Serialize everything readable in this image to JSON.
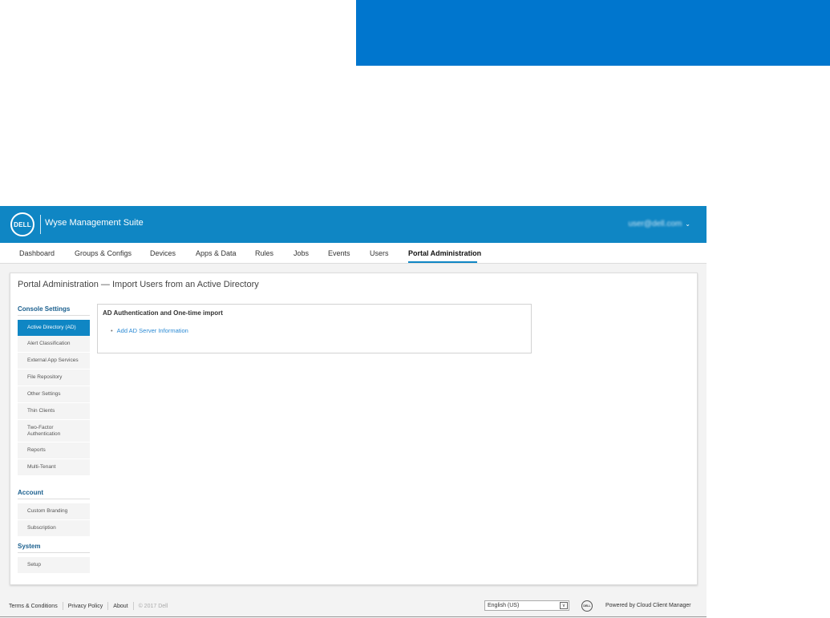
{
  "header": {
    "logo_text": "DELL",
    "app_title": "Wyse Management Suite",
    "user_email": "user@dell.com",
    "user_chevron": "⌄"
  },
  "nav": {
    "items": [
      {
        "label": "Dashboard"
      },
      {
        "label": "Groups & Configs"
      },
      {
        "label": "Devices"
      },
      {
        "label": "Apps & Data"
      },
      {
        "label": "Rules"
      },
      {
        "label": "Jobs"
      },
      {
        "label": "Events"
      },
      {
        "label": "Users"
      },
      {
        "label": "Portal Administration",
        "active": true
      }
    ]
  },
  "page": {
    "title": "Portal Administration — Import Users from an Active Directory"
  },
  "sidebar": {
    "console_heading": "Console Settings",
    "console_items": [
      {
        "label": "Active Directory (AD)",
        "active": true
      },
      {
        "label": "Alert Classification"
      },
      {
        "label": "External App Services"
      },
      {
        "label": "File Repository"
      },
      {
        "label": "Other Settings"
      },
      {
        "label": "Thin Clients"
      },
      {
        "label": "Two-Factor Authentication"
      },
      {
        "label": "Reports"
      },
      {
        "label": "Multi-Tenant"
      }
    ],
    "account_heading": "Account",
    "account_items": [
      {
        "label": "Custom Branding"
      },
      {
        "label": "Subscription"
      }
    ],
    "system_heading": "System",
    "system_items": [
      {
        "label": "Setup"
      }
    ]
  },
  "content": {
    "section_title": "AD Authentication and One-time import",
    "bullet": "•",
    "add_link": "Add AD Server Information"
  },
  "footer": {
    "terms": "Terms & Conditions",
    "privacy": "Privacy Policy",
    "about": "About",
    "copyright": "© 2017 Dell",
    "language": "English (US)",
    "language_arrow": "v",
    "logo_text": "DELL",
    "powered_by": "Powered by Cloud Client Manager"
  },
  "colors": {
    "brand_blue": "#0f86c4",
    "top_block_blue": "#0076ce",
    "link_blue": "#2b8ad4"
  }
}
